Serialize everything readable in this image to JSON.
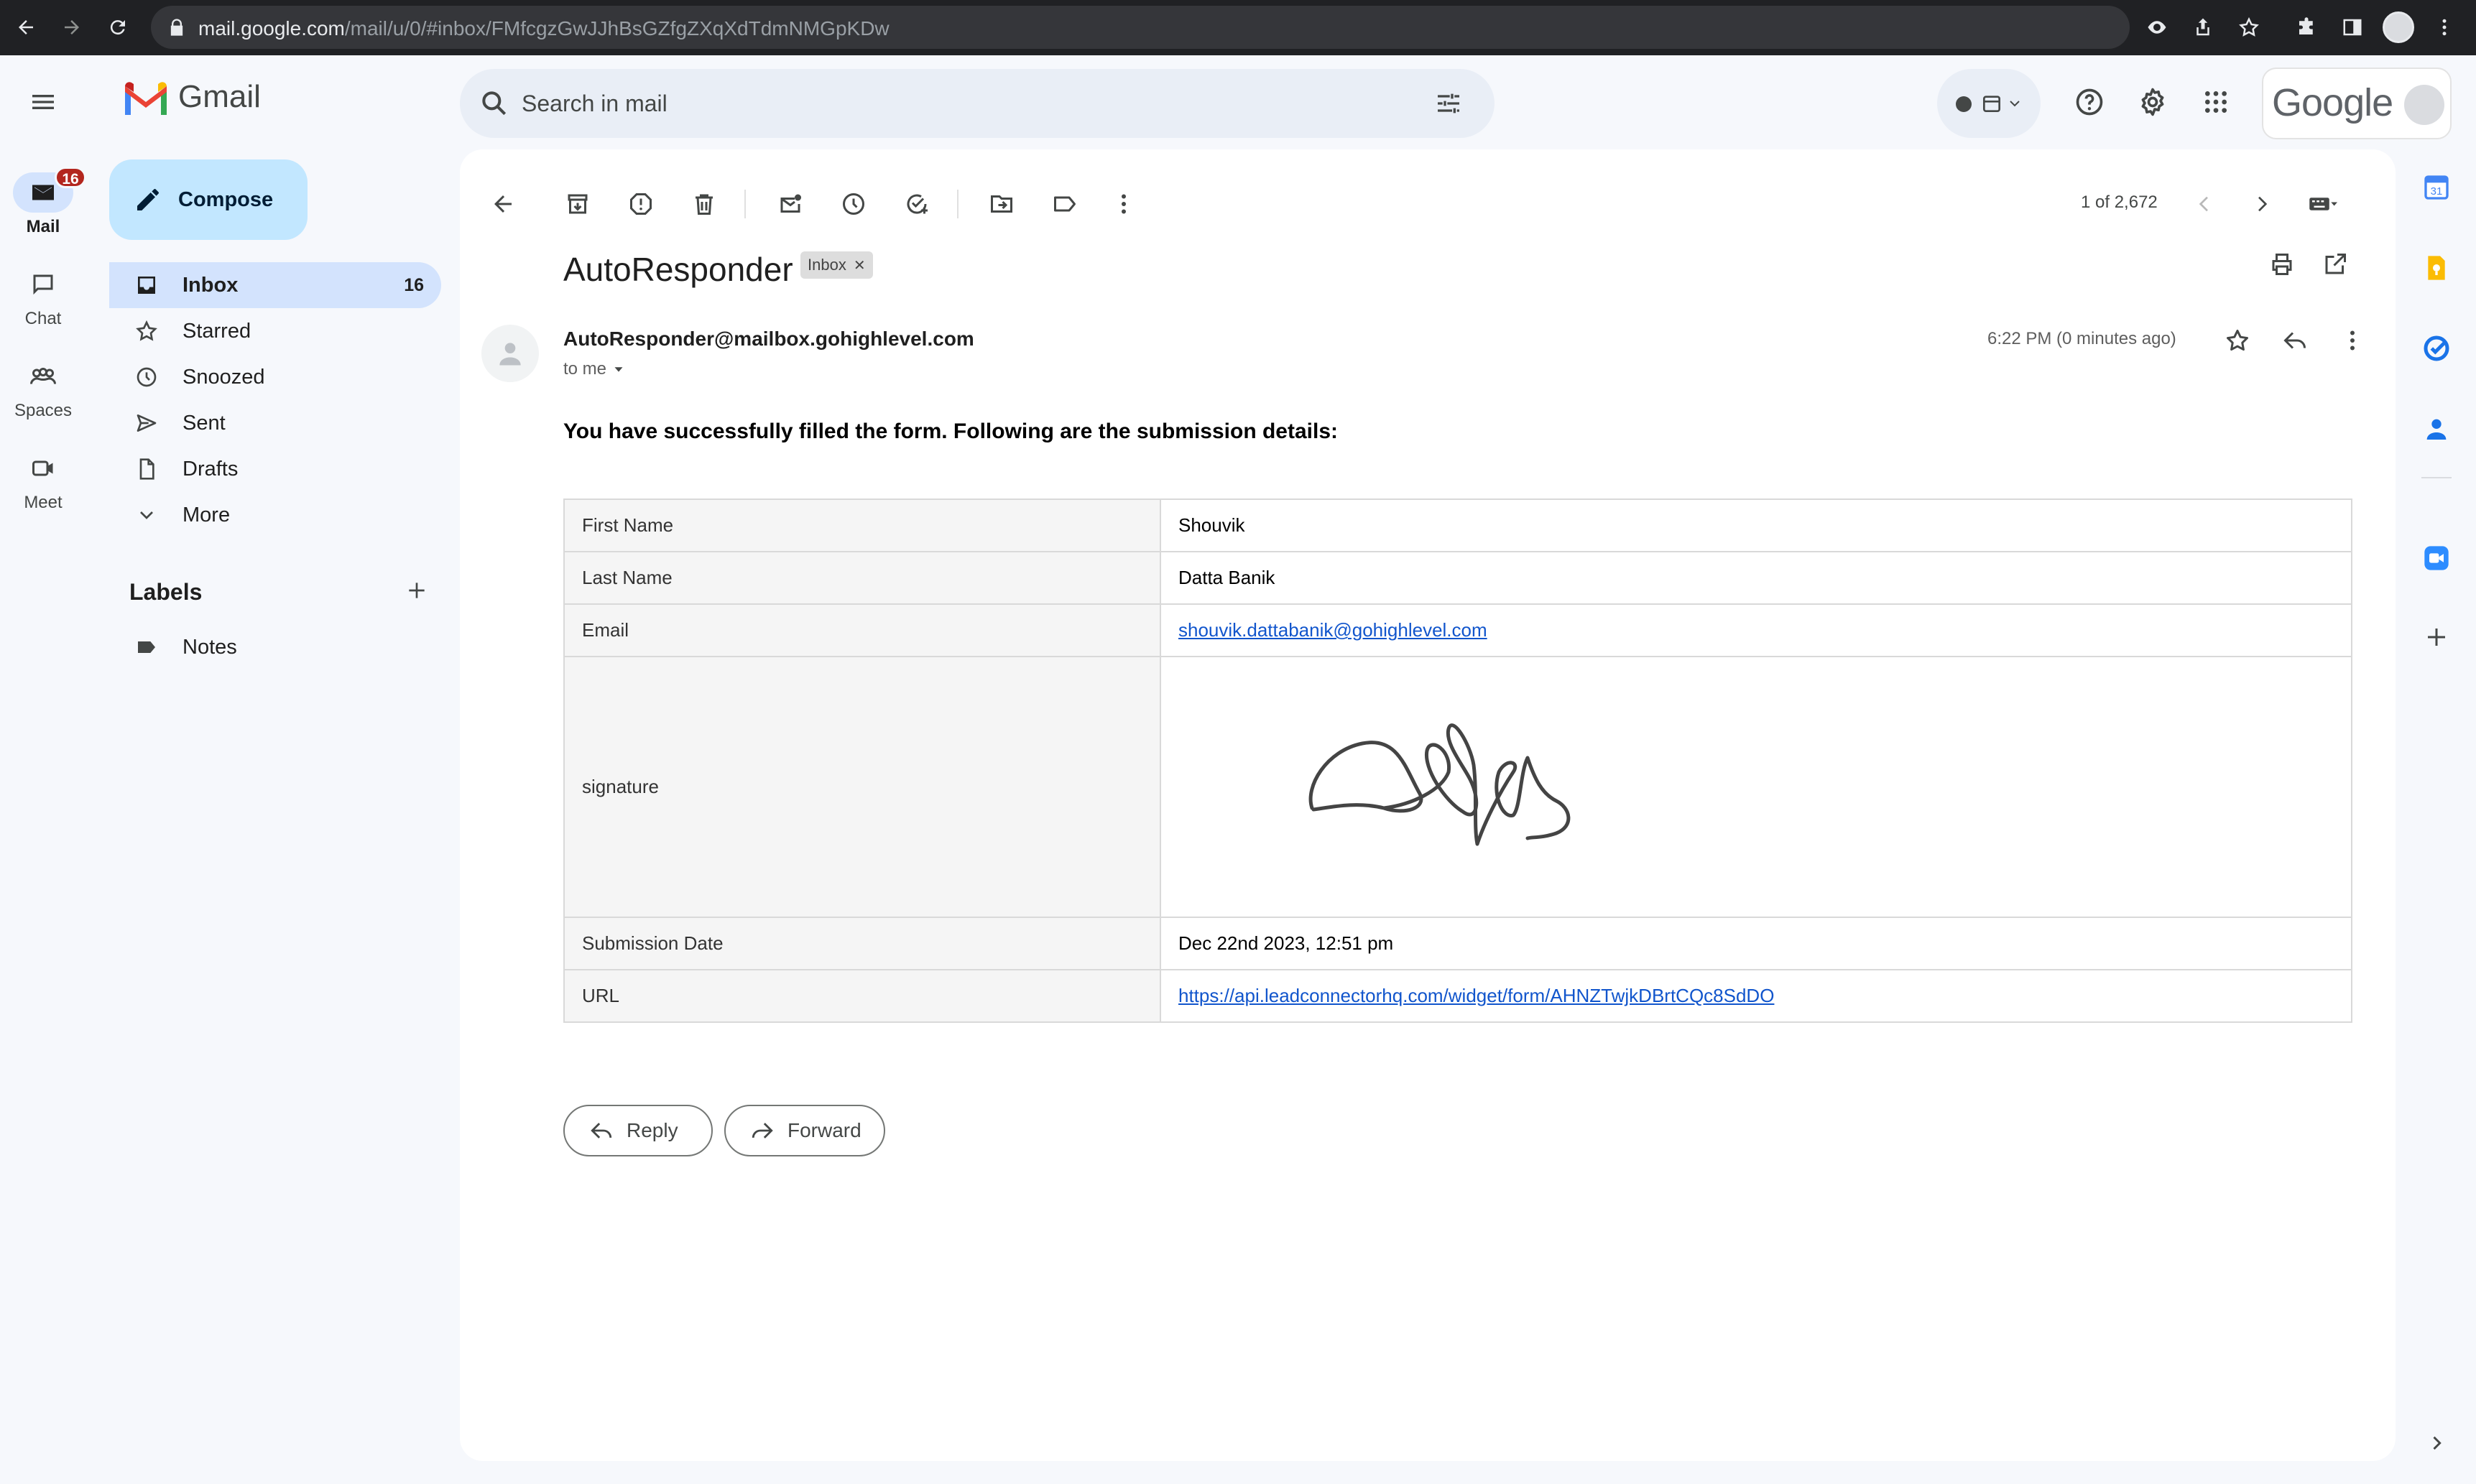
{
  "browser": {
    "url_host": "mail.google.com",
    "url_path": "/mail/u/0/#inbox/FMfcgzGwJJhBsGZfgZXqXdTdmNMGpKDw"
  },
  "rail": {
    "items": [
      {
        "label": "Mail",
        "badge": "16"
      },
      {
        "label": "Chat"
      },
      {
        "label": "Spaces"
      },
      {
        "label": "Meet"
      }
    ]
  },
  "app": {
    "name": "Gmail"
  },
  "sidebar": {
    "compose_label": "Compose",
    "items": [
      {
        "label": "Inbox",
        "count": "16"
      },
      {
        "label": "Starred"
      },
      {
        "label": "Snoozed"
      },
      {
        "label": "Sent"
      },
      {
        "label": "Drafts"
      },
      {
        "label": "More"
      }
    ],
    "labels_heading": "Labels",
    "labels": [
      {
        "label": "Notes"
      }
    ]
  },
  "search": {
    "placeholder": "Search in mail"
  },
  "account": {
    "wordmark": "Google"
  },
  "toolbar": {
    "pagination": "1 of 2,672"
  },
  "message": {
    "subject": "AutoResponder",
    "label_chip": "Inbox",
    "sender": "AutoResponder@mailbox.gohighlevel.com",
    "recipient": "to me",
    "time": "6:22 PM (0 minutes ago)",
    "intro": "You have successfully filled the form. Following are the submission details:",
    "rows": [
      {
        "key": "First Name",
        "value": "Shouvik"
      },
      {
        "key": "Last Name",
        "value": "Datta Banik"
      },
      {
        "key": "Email",
        "value": "shouvik.dattabanik@gohighlevel.com"
      },
      {
        "key": "signature",
        "value": ""
      },
      {
        "key": "Submission Date",
        "value": "Dec 22nd 2023, 12:51 pm"
      },
      {
        "key": "URL",
        "value": "https://api.leadconnectorhq.com/widget/form/AHNZTwjkDBrtCQc8SdDO"
      }
    ],
    "reply_label": "Reply",
    "forward_label": "Forward"
  },
  "colors": {
    "accent": "#0b57d0",
    "active_nav": "#d3e3fd",
    "compose": "#c2e7ff",
    "badge": "#b3261e",
    "link": "#1155cc"
  }
}
